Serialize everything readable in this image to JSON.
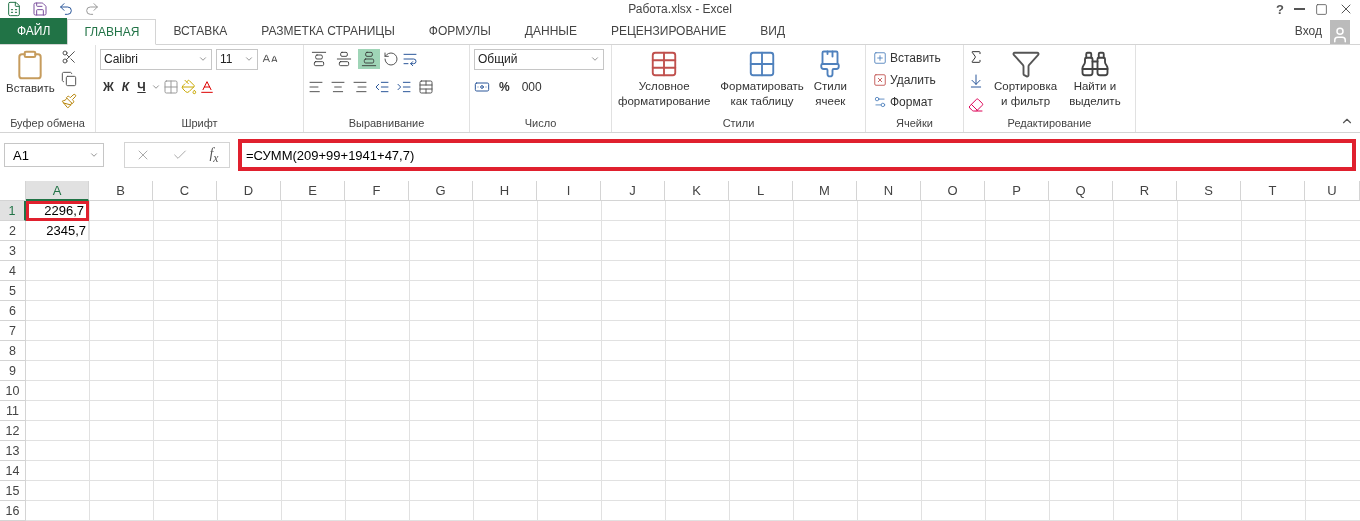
{
  "title_bar": {
    "title": "Работа.xlsx - Excel",
    "help": "?"
  },
  "tabs": [
    {
      "label": "ФАЙЛ",
      "kind": "file",
      "selected": false
    },
    {
      "label": "ГЛАВНАЯ",
      "kind": "tab",
      "selected": true
    },
    {
      "label": "ВСТАВКА",
      "kind": "tab",
      "selected": false
    },
    {
      "label": "РАЗМЕТКА СТРАНИЦЫ",
      "kind": "tab",
      "selected": false
    },
    {
      "label": "ФОРМУЛЫ",
      "kind": "tab",
      "selected": false
    },
    {
      "label": "ДАННЫЕ",
      "kind": "tab",
      "selected": false
    },
    {
      "label": "РЕЦЕНЗИРОВАНИЕ",
      "kind": "tab",
      "selected": false
    },
    {
      "label": "ВИД",
      "kind": "tab",
      "selected": false
    }
  ],
  "sign_in": "Вход",
  "ribbon": {
    "clipboard": {
      "paste": "Вставить",
      "label": "Буфер обмена"
    },
    "font": {
      "name": "Calibri",
      "size": "11",
      "bold": "Ж",
      "italic": "К",
      "underline": "Ч",
      "label": "Шрифт"
    },
    "alignment": {
      "vertical": [
        {
          "selected": false
        },
        {
          "selected": false
        },
        {
          "selected": true
        }
      ],
      "label": "Выравнивание"
    },
    "number": {
      "format": "Общий",
      "percent": "%",
      "thousands": "000",
      "label": "Число"
    },
    "styles": {
      "buttons": [
        {
          "lines": [
            "Условное",
            "форматирование"
          ]
        },
        {
          "lines": [
            "Форматировать",
            "как таблицу"
          ]
        },
        {
          "lines": [
            "Стили",
            "ячеек"
          ]
        }
      ],
      "label": "Стили"
    },
    "cells": {
      "buttons": [
        "Вставить",
        "Удалить",
        "Формат"
      ],
      "label": "Ячейки"
    },
    "editing": {
      "buttons": [
        {
          "lines": [
            "Сортировка",
            "и фильтр"
          ]
        },
        {
          "lines": [
            "Найти и",
            "выделить"
          ]
        }
      ],
      "label": "Редактирование"
    }
  },
  "formula_bar": {
    "name_box": "A1",
    "fx": "f$_{x}$",
    "formula": "=СУММ(209+99+1941+47,7)",
    "highlighted": true
  },
  "grid": {
    "columns": [
      {
        "label": "A",
        "selected": true
      },
      {
        "label": "B",
        "selected": false
      },
      {
        "label": "C",
        "selected": false
      },
      {
        "label": "D",
        "selected": false
      },
      {
        "label": "E",
        "selected": false
      },
      {
        "label": "F",
        "selected": false
      },
      {
        "label": "G",
        "selected": false
      },
      {
        "label": "H",
        "selected": false
      },
      {
        "label": "I",
        "selected": false
      },
      {
        "label": "J",
        "selected": false
      },
      {
        "label": "K",
        "selected": false
      },
      {
        "label": "L",
        "selected": false
      },
      {
        "label": "M",
        "selected": false
      },
      {
        "label": "N",
        "selected": false
      },
      {
        "label": "O",
        "selected": false
      },
      {
        "label": "P",
        "selected": false
      },
      {
        "label": "Q",
        "selected": false
      },
      {
        "label": "R",
        "selected": false
      },
      {
        "label": "S",
        "selected": false
      },
      {
        "label": "T",
        "selected": false
      },
      {
        "label": "U",
        "selected": false
      }
    ],
    "rows": [
      {
        "number": "1",
        "selected": true,
        "cells": [
          {
            "value": "2296,7",
            "highlighted": true
          }
        ]
      },
      {
        "number": "2",
        "selected": false,
        "cells": [
          {
            "value": "2345,7",
            "highlighted": false
          }
        ]
      },
      {
        "number": "3",
        "selected": false
      },
      {
        "number": "4",
        "selected": false
      },
      {
        "number": "5",
        "selected": false
      },
      {
        "number": "6",
        "selected": false
      },
      {
        "number": "7",
        "selected": false
      },
      {
        "number": "8",
        "selected": false
      },
      {
        "number": "9",
        "selected": false
      },
      {
        "number": "10",
        "selected": false
      },
      {
        "number": "11",
        "selected": false
      },
      {
        "number": "12",
        "selected": false
      },
      {
        "number": "13",
        "selected": false
      },
      {
        "number": "14",
        "selected": false
      },
      {
        "number": "15",
        "selected": false
      },
      {
        "number": "16",
        "selected": false
      }
    ]
  }
}
